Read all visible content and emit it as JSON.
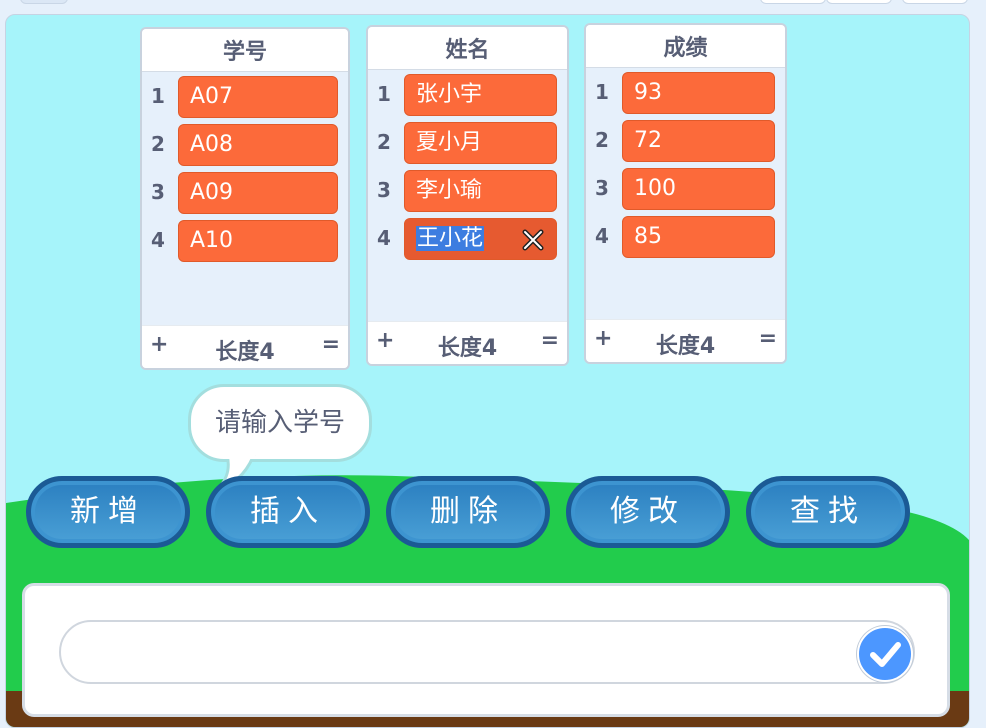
{
  "lists": [
    {
      "title": "学号",
      "items": [
        "A07",
        "A08",
        "A09",
        "A10"
      ],
      "footer": {
        "plus": "+",
        "length": "长度4",
        "equals": "="
      }
    },
    {
      "title": "姓名",
      "items": [
        "张小宇",
        "夏小月",
        "李小瑜",
        "王小花"
      ],
      "editing_index": 3,
      "footer": {
        "plus": "+",
        "length": "长度4",
        "equals": "="
      }
    },
    {
      "title": "成绩",
      "items": [
        "93",
        "72",
        "100",
        "85"
      ],
      "footer": {
        "plus": "+",
        "length": "长度4",
        "equals": "="
      }
    }
  ],
  "bubble_text": "请输入学号",
  "buttons": [
    "新增",
    "插入",
    "删除",
    "修改",
    "查找"
  ],
  "ask": {
    "value": ""
  },
  "colors": {
    "sky": "#a6f4fa",
    "grass": "#22cc4c",
    "list_item": "#fc6a3a",
    "button": "#2b7fc0",
    "submit": "#4c97ff"
  }
}
